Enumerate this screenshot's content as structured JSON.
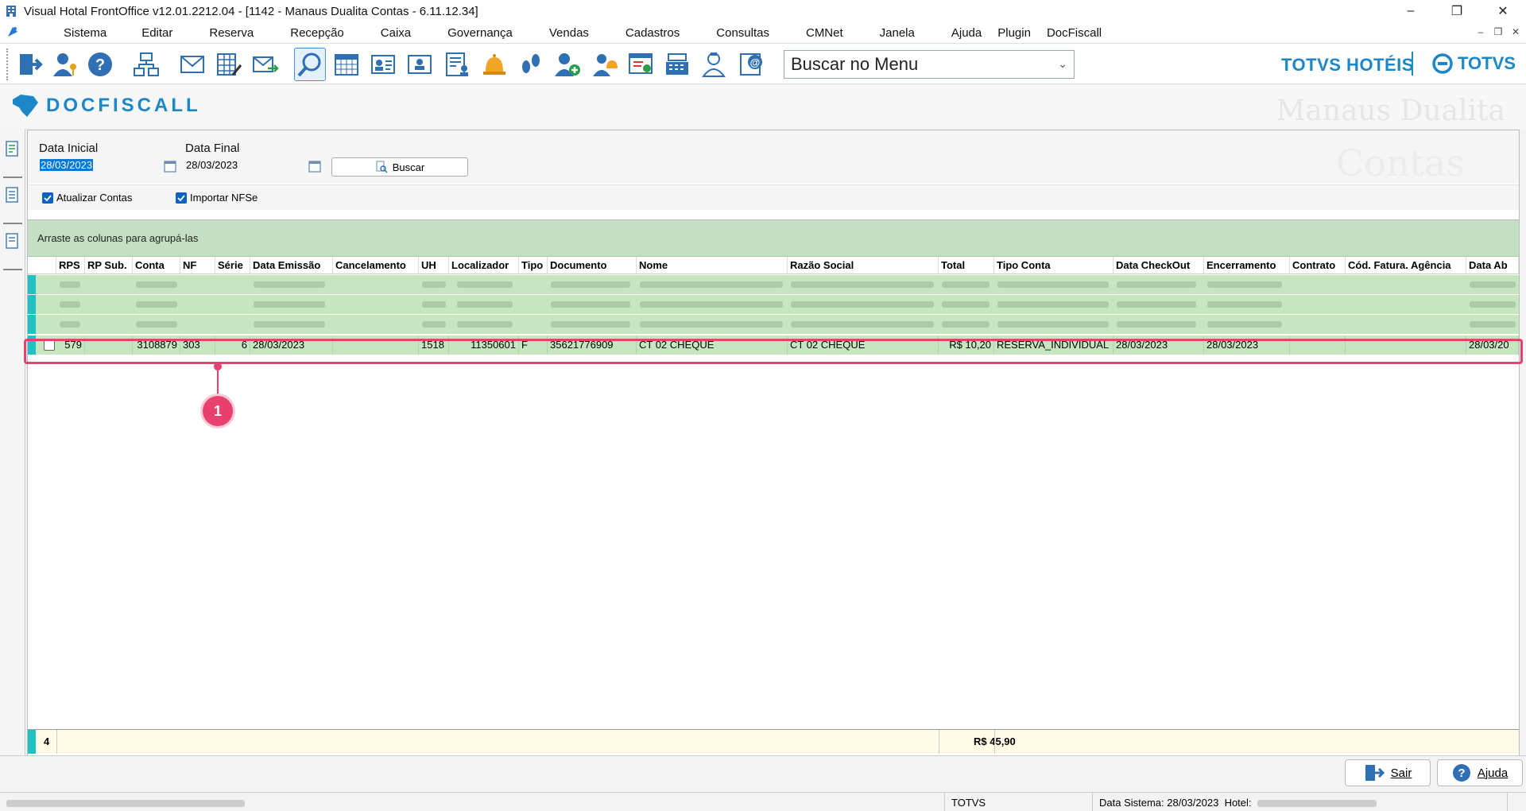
{
  "window": {
    "title": "Visual Hotal FrontOffice v12.01.2212.04 - [1142 - Manaus Dualita Contas - 6.11.12.34]",
    "minimize": "–",
    "restore": "❐",
    "close": "✕"
  },
  "menu": {
    "items": [
      "Sistema",
      "Editar",
      "Reserva",
      "Recepção",
      "Caixa",
      "Governança",
      "Vendas",
      "Cadastros",
      "Consultas",
      "CMNet",
      "Janela",
      "Ajuda",
      "Plugin",
      "DocFiscall"
    ]
  },
  "toolbar": {
    "search_menu_value": "Buscar no Menu",
    "brand_hoteis": "TOTVS HOTÉIS",
    "brand_totvs": "TOTVS"
  },
  "module": {
    "logo_text": "DOCFISCALL",
    "hotel_name": "Manaus Dualita"
  },
  "filters": {
    "data_inicial_label": "Data Inicial",
    "data_inicial_value": "28/03/2023",
    "data_final_label": "Data Final",
    "data_final_value": "28/03/2023",
    "buscar_label": "Buscar",
    "watermark": "Contas",
    "atualizar_contas_label": "Atualizar Contas",
    "importar_nfse_label": "Importar NFSe"
  },
  "grid": {
    "group_hint": "Arraste as colunas para agrupá-las",
    "columns": [
      "RPS",
      "RP Sub.",
      "Conta",
      "NF",
      "Série",
      "Data Emissão",
      "Cancelamento",
      "UH",
      "Localizador",
      "Tipo",
      "Documento",
      "Nome",
      "Razão Social",
      "Total",
      "Tipo Conta",
      "Data CheckOut",
      "Encerramento",
      "Contrato",
      "Cód. Fatura. Agência",
      "Data Ab"
    ],
    "highlighted_row": {
      "rps": "579",
      "rp_sub": "",
      "conta": "3108879",
      "nf": "303",
      "serie": "6",
      "data_emissao": "28/03/2023",
      "cancelamento": "",
      "uh": "1518",
      "localizador": "11350601",
      "tipo": "F",
      "documento": "35621776909",
      "nome": "CT 02 CHEQUE",
      "razao_social": "CT 02 CHEQUE",
      "total": "R$ 10,20",
      "tipo_conta": "RESERVA_INDIVIDUAL",
      "data_checkout": "28/03/2023",
      "encerramento": "28/03/2023",
      "contrato": "",
      "cod_fatura": "",
      "data_ab": "28/03/20"
    },
    "footer_count": "4",
    "footer_total": "R$ 45,90",
    "callout_number": "1"
  },
  "actions": {
    "sair_label": "Sair",
    "ajuda_label": "Ajuda"
  },
  "status": {
    "company": "TOTVS",
    "data_sistema": "Data Sistema: 28/03/2023",
    "hotel_label": "Hotel:"
  },
  "colors": {
    "accent": "#1b87c9",
    "row_green": "#c6e6bf",
    "indicator": "#1fc2c2",
    "callout": "#e8416f"
  }
}
